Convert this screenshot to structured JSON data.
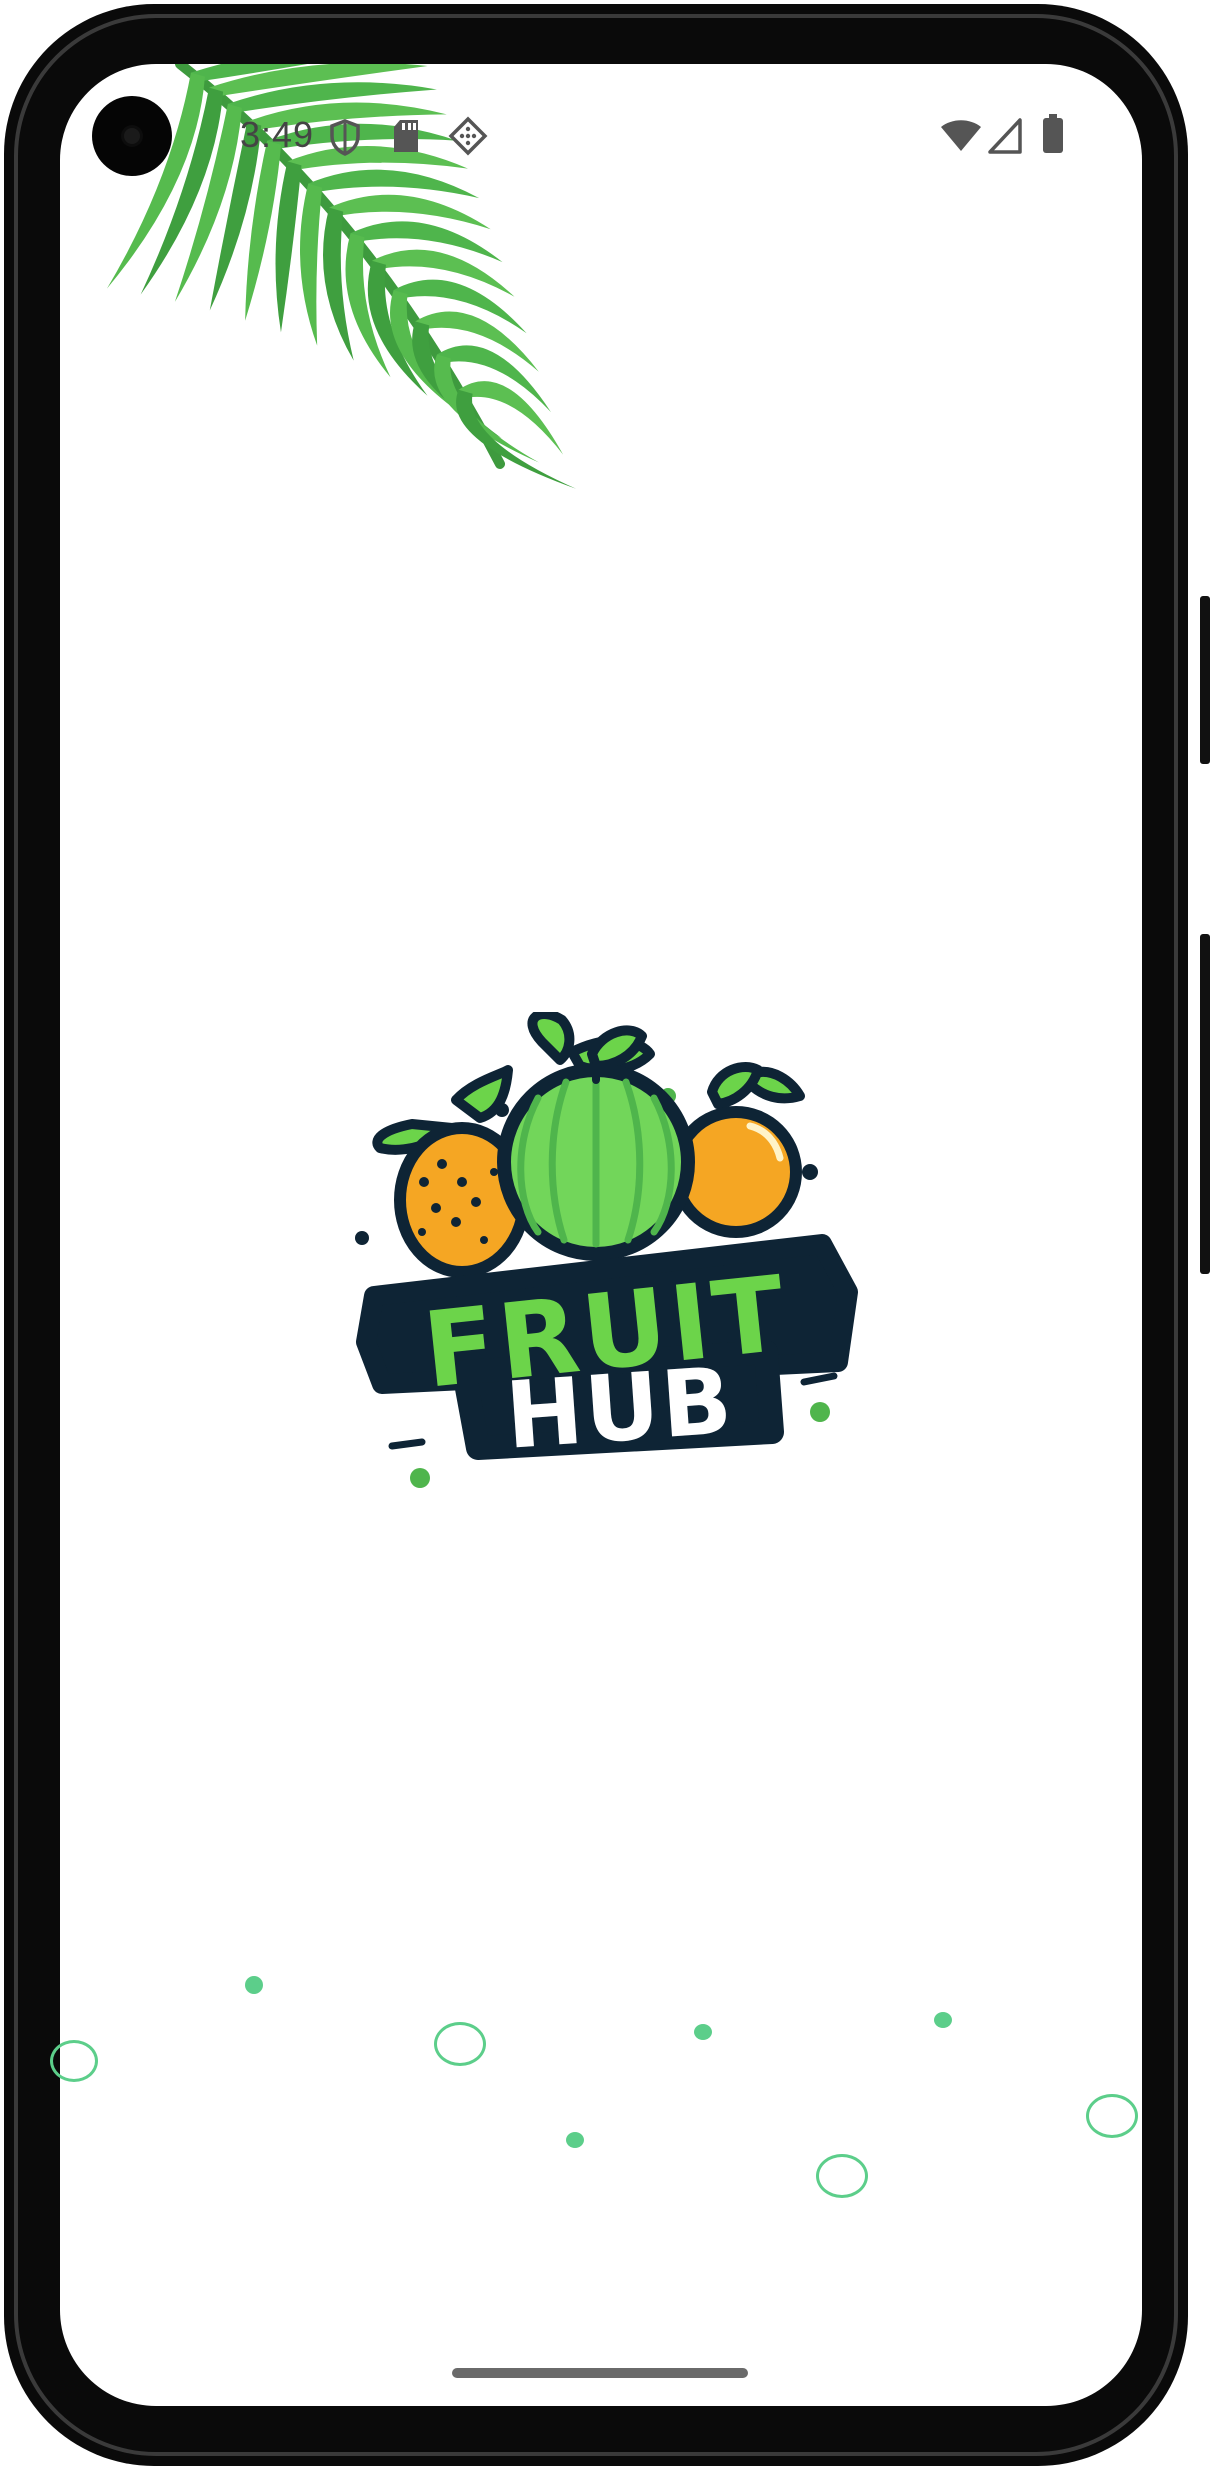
{
  "status_bar": {
    "time": "3:49",
    "left_icons": [
      "shield-icon",
      "sd-card-icon",
      "diamond-grid-icon"
    ],
    "right_icons": [
      "wifi-icon",
      "cellular-signal-icon",
      "battery-icon"
    ]
  },
  "splash": {
    "logo": {
      "word_top": "FRUIT",
      "word_bottom": "HUB",
      "icon": "fruit-basket-logo"
    },
    "decor": [
      "palm-leaf",
      "green-bubbles"
    ]
  },
  "colors": {
    "brand_green": "#6cd44a",
    "dark_navy": "#0e2435",
    "orange": "#f5a623",
    "leaf_green": "#4fb54c",
    "bubble_green": "#5cce8a",
    "background": "#ffffff"
  }
}
